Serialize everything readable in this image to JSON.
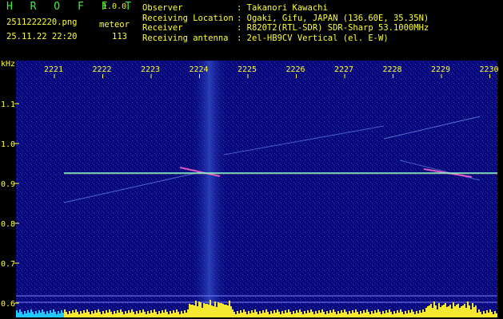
{
  "app": {
    "title": "H R O F F T",
    "version": "1.0.0"
  },
  "file": {
    "name": "2511222220.png",
    "datetime": "25.11.22 22:20"
  },
  "detector": {
    "label": "meteor",
    "count": "113"
  },
  "info": [
    {
      "key": "Observer",
      "value": ": Takanori Kawachi"
    },
    {
      "key": "Receiving Location",
      "value": ": Ogaki, Gifu, JAPAN (136.60E, 35.35N)"
    },
    {
      "key": "Receiver",
      "value": ": R820T2(RTL-SDR) SDR-Sharp 53.1000MHz"
    },
    {
      "key": "Receiving antenna",
      "value": ": 2el-HB9CV Vertical (el. E-W)"
    }
  ],
  "axis": {
    "unit": "kHz",
    "time_ticks": [
      "2221",
      "2222",
      "2223",
      "2224",
      "2225",
      "2226",
      "2227",
      "2228",
      "2229",
      "2230"
    ],
    "freq_ticks": [
      "1.1",
      "1.0",
      "0.9",
      "0.8",
      "0.7",
      "0.6"
    ]
  },
  "colors": {
    "background": "#000000",
    "spectrogram": "#0a0a7a",
    "carrier": "#7fffd4",
    "text_green": "#3cf03c",
    "text_yellow": "#ffff30"
  }
}
